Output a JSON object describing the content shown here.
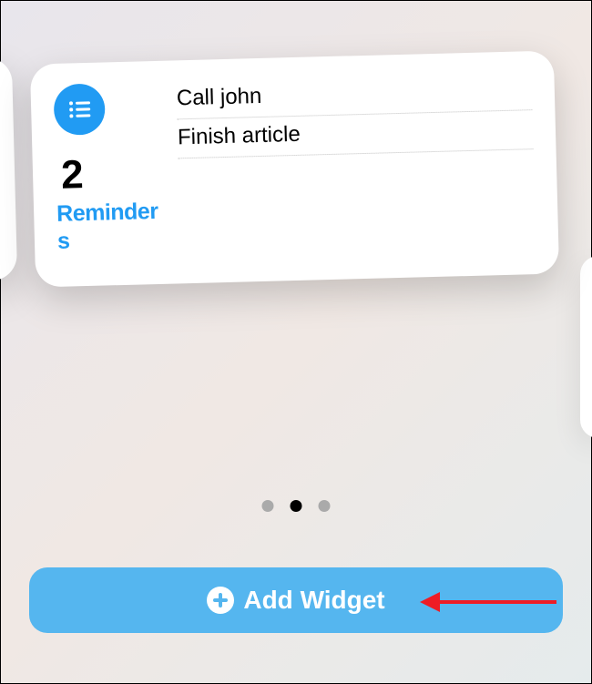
{
  "widget": {
    "count": "2",
    "label": "Reminders",
    "items": [
      "Call john",
      "Finish article"
    ]
  },
  "pagination": {
    "total": 3,
    "active": 1
  },
  "button": {
    "label": "Add Widget"
  }
}
